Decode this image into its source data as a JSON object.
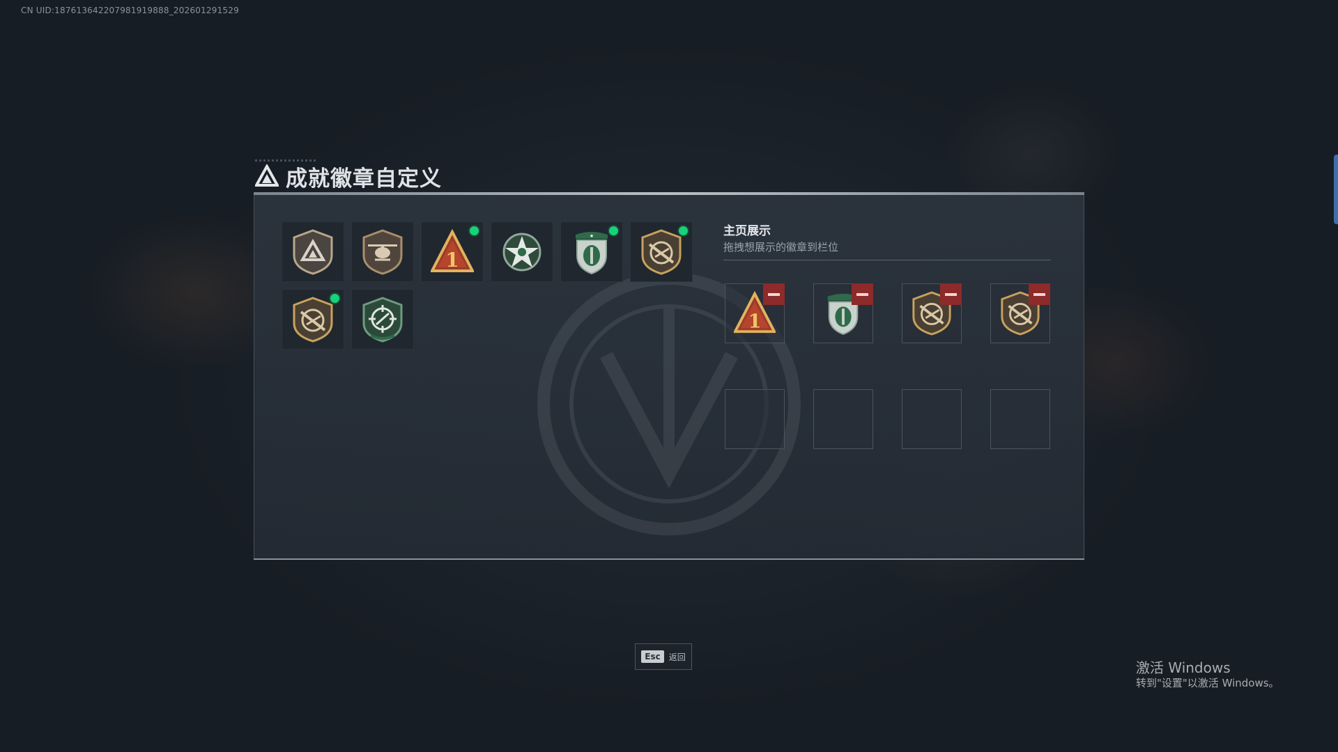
{
  "uid": "CN UID:187613642207981919888_202601291529",
  "title": "成就徽章自定义",
  "title_icon": "delta-triangle-icon",
  "owned_badges": [
    {
      "name": "delta-shield-badge",
      "new": false
    },
    {
      "name": "helicopter-shield-badge",
      "new": false
    },
    {
      "name": "number-one-triangle-badge",
      "new": true
    },
    {
      "name": "green-star-badge",
      "new": false
    },
    {
      "name": "green-military-shield-badge",
      "new": true
    },
    {
      "name": "rifle-shield-badge",
      "new": true
    },
    {
      "name": "rifle-shield-badge",
      "new": true
    },
    {
      "name": "green-target-badge",
      "new": false
    }
  ],
  "display": {
    "title": "主页展示",
    "subtitle": "拖拽想展示的徽章到栏位",
    "slots": [
      {
        "badge": "number-one-triangle-badge",
        "removable": true
      },
      {
        "badge": "green-military-shield-badge",
        "removable": true
      },
      {
        "badge": "rifle-shield-badge",
        "removable": true
      },
      {
        "badge": "rifle-shield-badge",
        "removable": true
      },
      {
        "badge": null,
        "removable": false
      },
      {
        "badge": null,
        "removable": false
      },
      {
        "badge": null,
        "removable": false
      },
      {
        "badge": null,
        "removable": false
      }
    ]
  },
  "esc": {
    "key": "Esc",
    "label": "返回"
  },
  "windows": {
    "line1": "激活 Windows",
    "line2": "转到\"设置\"以激活 Windows。"
  },
  "colors": {
    "new_dot": "#16d27a",
    "remove_button": "#8d2a2a",
    "gold": "#c8a25e",
    "green": "#2f6b4a"
  }
}
